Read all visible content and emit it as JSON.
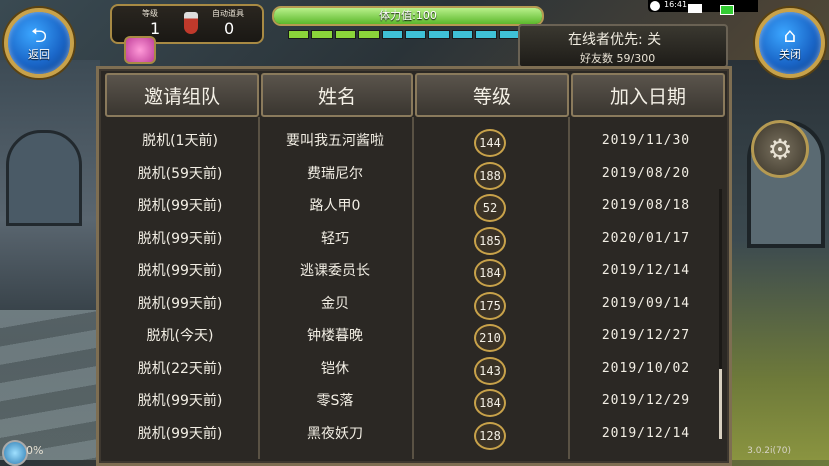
{
  "hud": {
    "back_label": "返回",
    "close_label": "关闭",
    "level_label": "等级",
    "level_value": "1",
    "auto_items_label": "自动道具",
    "auto_items_value": "0",
    "stamina_text": "体力值:100",
    "stamina_fraction": 1.0,
    "time": "16:41",
    "online_priority": "在线者优先: 关",
    "friend_count": "好友数 59/300",
    "bottom_percent": "0%",
    "version": "3.0.2i(70)"
  },
  "table": {
    "headers": [
      "邀请组队",
      "姓名",
      "等级",
      "加入日期"
    ],
    "rows": [
      {
        "status": "脱机(1天前)",
        "name": "要叫我五河酱啦",
        "level": "144",
        "date": "2019/11/30"
      },
      {
        "status": "脱机(59天前)",
        "name": "费瑞尼尔",
        "level": "188",
        "date": "2019/08/20"
      },
      {
        "status": "脱机(99天前)",
        "name": "路人甲0",
        "level": "52",
        "date": "2019/08/18"
      },
      {
        "status": "脱机(99天前)",
        "name": "轻巧",
        "level": "185",
        "date": "2020/01/17"
      },
      {
        "status": "脱机(99天前)",
        "name": "逃课委员长",
        "level": "184",
        "date": "2019/12/14"
      },
      {
        "status": "脱机(99天前)",
        "name": "金贝",
        "level": "175",
        "date": "2019/09/14"
      },
      {
        "status": "脱机(今天)",
        "name": "钟楼暮晚",
        "level": "210",
        "date": "2019/12/27"
      },
      {
        "status": "脱机(22天前)",
        "name": "铠休",
        "level": "143",
        "date": "2019/10/02"
      },
      {
        "status": "脱机(99天前)",
        "name": "零S落",
        "level": "184",
        "date": "2019/12/29"
      },
      {
        "status": "脱机(99天前)",
        "name": "黑夜妖刀",
        "level": "128",
        "date": "2019/12/14"
      }
    ]
  },
  "icons": [
    "back-arrow-icon",
    "home-icon",
    "gear-icon",
    "gift-icon",
    "potion-icon",
    "clock-icon",
    "mail-icon",
    "battery-icon"
  ]
}
